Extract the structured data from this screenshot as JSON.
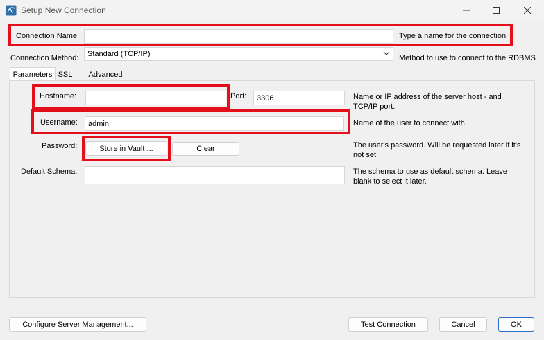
{
  "window": {
    "title": "Setup New Connection",
    "controls": {
      "minimize": "minimize",
      "maximize": "maximize",
      "close": "close"
    }
  },
  "connection_name": {
    "label": "Connection Name:",
    "value": "",
    "description": "Type a name for the connection"
  },
  "connection_method": {
    "label": "Connection Method:",
    "value": "Standard (TCP/IP)",
    "description": "Method to use to connect to the RDBMS"
  },
  "tabs": [
    {
      "label": "Parameters",
      "active": true
    },
    {
      "label": "SSL",
      "active": false
    },
    {
      "label": "Advanced",
      "active": false
    }
  ],
  "parameters": {
    "hostname": {
      "label": "Hostname:",
      "value": ""
    },
    "port": {
      "label": "Port:",
      "value": "3306"
    },
    "hostname_description": "Name or IP address of the server host - and TCP/IP port.",
    "username": {
      "label": "Username:",
      "value": "admin",
      "description": "Name of the user to connect with."
    },
    "password": {
      "label": "Password:",
      "store_button": "Store in Vault ...",
      "clear_button": "Clear",
      "description": "The user's password. Will be requested later if it's not set."
    },
    "default_schema": {
      "label": "Default Schema:",
      "value": "",
      "description": "The schema to use as default schema. Leave blank to select it later."
    }
  },
  "footer": {
    "configure_button": "Configure Server Management...",
    "test_button": "Test Connection",
    "cancel_button": "Cancel",
    "ok_button": "OK"
  },
  "colors": {
    "highlight": "#e3101c",
    "accent": "#2a6fcf",
    "background": "#f0f0f0"
  }
}
